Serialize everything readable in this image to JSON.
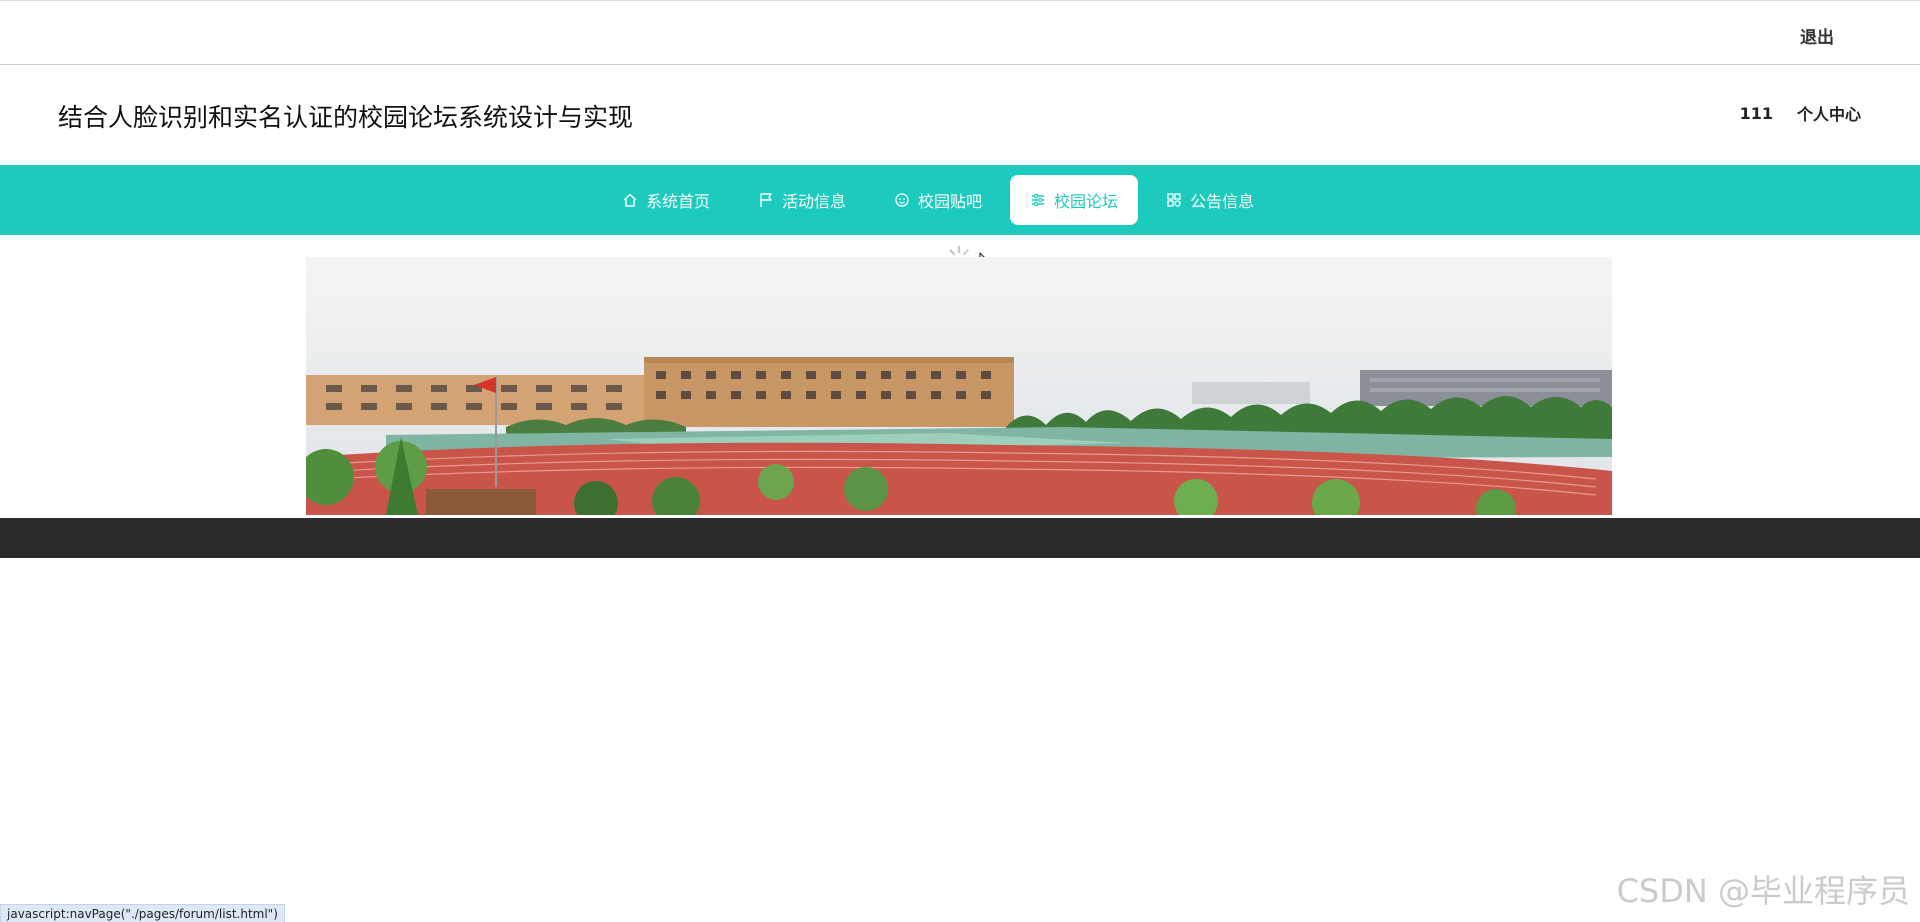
{
  "topbar": {
    "logout_label": "退出"
  },
  "header": {
    "site_title": "结合人脸识别和实名认证的校园论坛系统设计与实现",
    "username": "111",
    "profile_label": "个人中心"
  },
  "nav": {
    "items": [
      {
        "label": "系统首页",
        "icon": "home-icon",
        "active": false
      },
      {
        "label": "活动信息",
        "icon": "flag-icon",
        "active": false
      },
      {
        "label": "校园贴吧",
        "icon": "face-icon",
        "active": false
      },
      {
        "label": "校园论坛",
        "icon": "sliders-icon",
        "active": true
      },
      {
        "label": "公告信息",
        "icon": "grid-icon",
        "active": false
      }
    ],
    "accent_color": "#1ccbbd"
  },
  "banner": {
    "alt": "campus-playground-image"
  },
  "statusbar": {
    "text": "javascript:navPage(\"./pages/forum/list.html\")"
  },
  "watermark": {
    "text": "CSDN @毕业程序员"
  }
}
